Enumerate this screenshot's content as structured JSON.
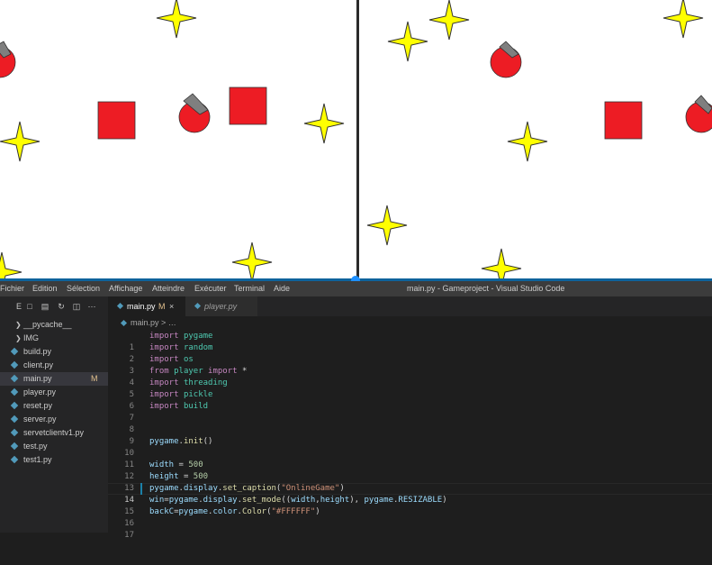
{
  "game": {
    "bg_color": "#ffffff",
    "star_color": "#ffff00",
    "shape_color": "#ed1c24",
    "cannon_color": "#7f7f7f"
  },
  "menubar": {
    "items": [
      "Fichier",
      "Edition",
      "Sélection",
      "Affichage",
      "Atteindre",
      "Exécuter",
      "Terminal",
      "Aide"
    ],
    "window_title": "main.py - Gameproject - Visual Studio Code"
  },
  "explorer": {
    "header_label": "E",
    "folders": [
      "__pycache__",
      "IMG"
    ],
    "files": [
      "build.py",
      "client.py",
      "main.py",
      "player.py",
      "reset.py",
      "server.py",
      "servetclientv1.py",
      "test.py",
      "test1.py"
    ],
    "active_file": "main.py",
    "active_badge": "M"
  },
  "tabs": [
    {
      "label": "main.py",
      "modified": "M",
      "close": "×"
    },
    {
      "label": "player.py"
    }
  ],
  "breadcrumb": "main.py > …",
  "editor": {
    "current_line": 14,
    "lines": [
      {
        "n": "1",
        "text": "import pygame"
      },
      {
        "n": "2",
        "text": "import random"
      },
      {
        "n": "3",
        "text": "import os"
      },
      {
        "n": "4",
        "text": "from player import *"
      },
      {
        "n": "5",
        "text": "import threading"
      },
      {
        "n": "6",
        "text": "import pickle"
      },
      {
        "n": "7",
        "text": "import build"
      },
      {
        "n": "8",
        "text": ""
      },
      {
        "n": "9",
        "text": ""
      },
      {
        "n": "10",
        "text": "pygame.init()"
      },
      {
        "n": "11",
        "text": ""
      },
      {
        "n": "12",
        "text": "width = 500"
      },
      {
        "n": "13",
        "text": "height = 500"
      },
      {
        "n": "14",
        "text": "pygame.display.set_caption(\"OnlineGame\")"
      },
      {
        "n": "15",
        "text": "win=pygame.display.set_mode((width,height), pygame.RESIZABLE)"
      },
      {
        "n": "16",
        "text": "backC=pygame.color.Color(\"#FFFFFF\")"
      },
      {
        "n": "17",
        "text": ""
      }
    ]
  }
}
